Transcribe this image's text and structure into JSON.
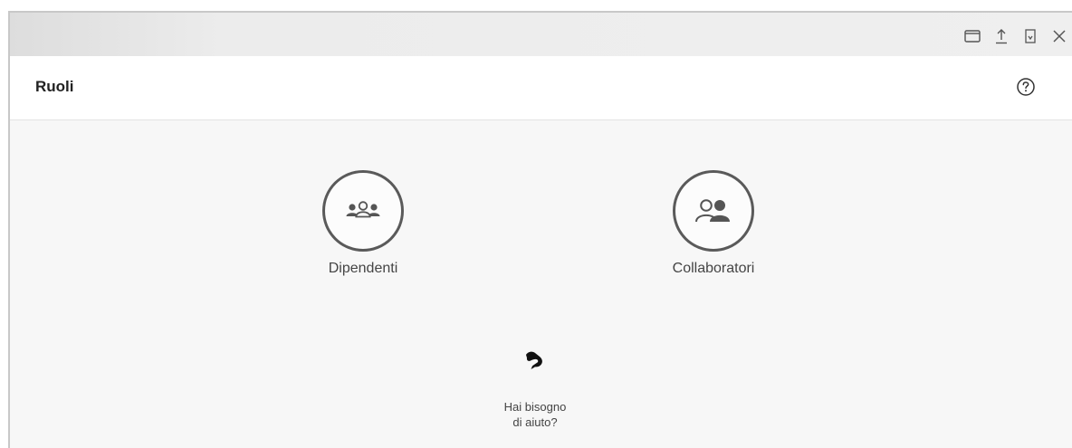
{
  "window": {
    "controls": [
      {
        "name": "window-icon",
        "label": ""
      },
      {
        "name": "upload-icon",
        "label": ""
      },
      {
        "name": "bookmark-icon",
        "label": ""
      },
      {
        "name": "close-icon",
        "label": ""
      }
    ]
  },
  "header": {
    "title": "Ruoli",
    "help_icon": "help-circle-icon"
  },
  "roles": [
    {
      "label": "Dipendenti",
      "icon": "group-users-icon"
    },
    {
      "label": "Collaboratori",
      "icon": "two-users-icon"
    }
  ],
  "support": {
    "line1": "Hai bisogno",
    "line2": "di aiuto?",
    "icon": "support-logo-icon"
  }
}
